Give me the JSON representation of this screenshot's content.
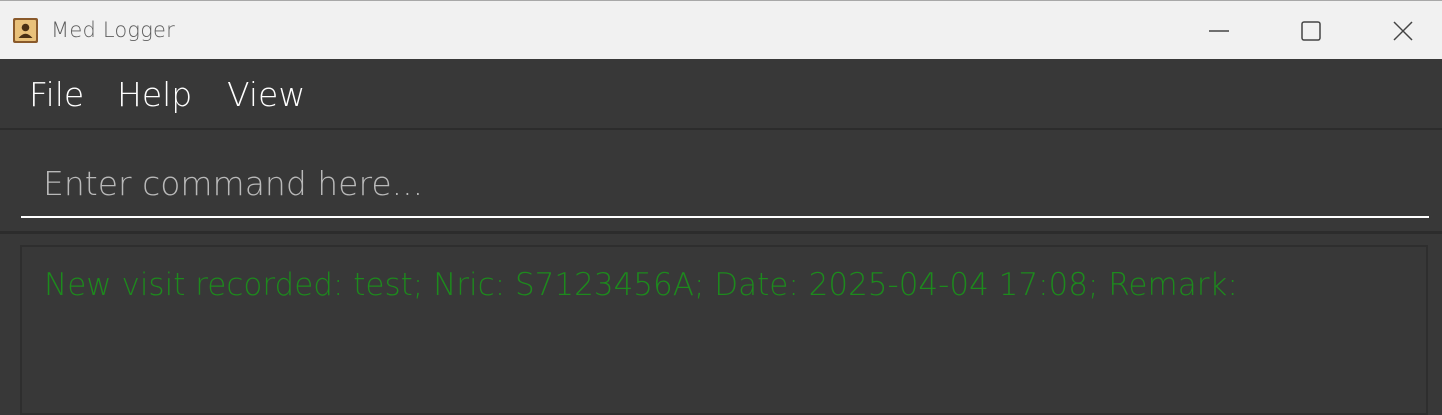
{
  "window": {
    "title": "Med Logger",
    "app_icon": "address-book-icon",
    "controls": {
      "minimize_icon": "minimize-icon",
      "maximize_icon": "maximize-icon",
      "close_icon": "close-icon"
    }
  },
  "menu": {
    "items": [
      {
        "label": "File"
      },
      {
        "label": "Help"
      },
      {
        "label": "View"
      }
    ]
  },
  "command": {
    "placeholder": "Enter command here...",
    "value": ""
  },
  "result": {
    "message": "New visit recorded: test; Nric: S7123456A; Date: 2025-04-04 17:08; Remark:"
  },
  "colors": {
    "background": "#383838",
    "titlebar": "#f1f1f1",
    "result_text": "#1d8a1d",
    "menu_text": "#ffffff"
  }
}
